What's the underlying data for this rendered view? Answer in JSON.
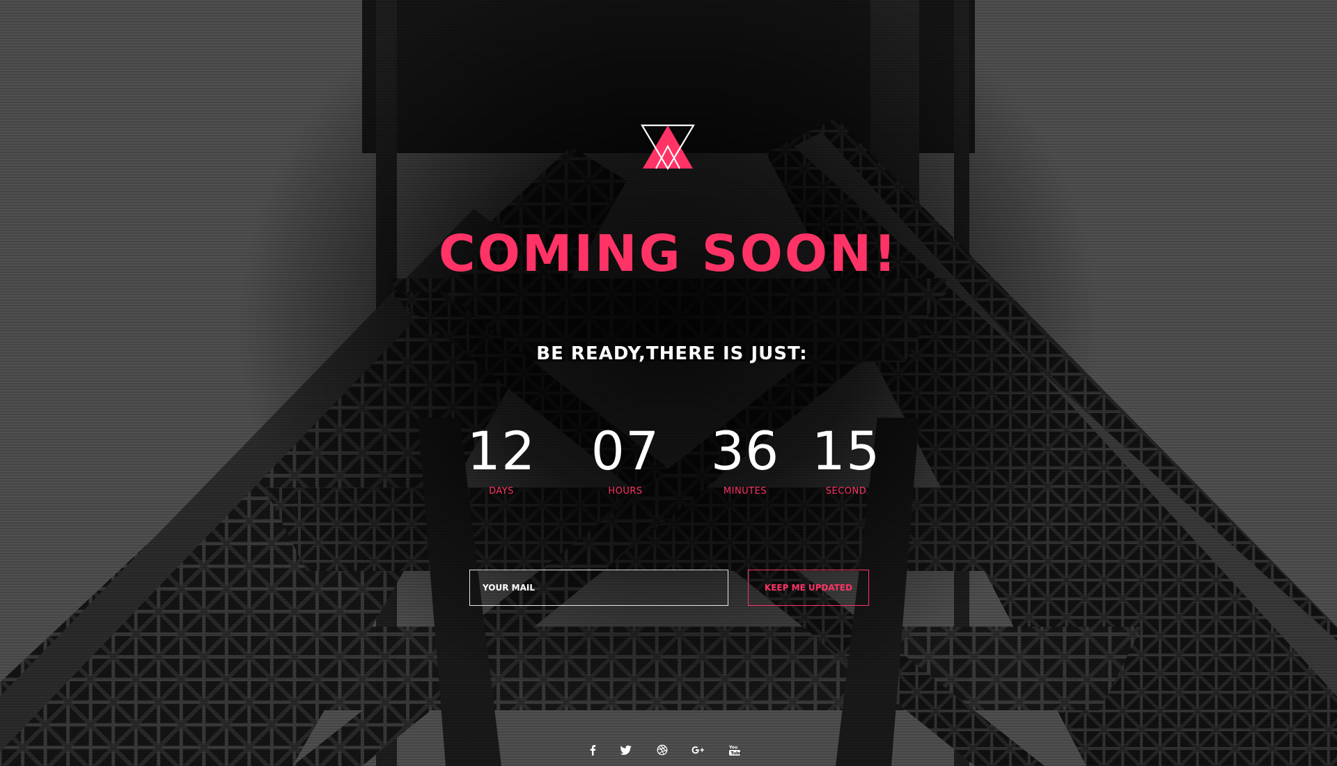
{
  "brand": {
    "accent_color": "#ff3366",
    "logo_icon": "triangle-logo-icon"
  },
  "hero": {
    "title": "COMING SOON!",
    "subtitle": "BE READY,THERE IS JUST:"
  },
  "countdown": [
    {
      "value": "12",
      "label": "DAYS"
    },
    {
      "value": "07",
      "label": "HOURS"
    },
    {
      "value": "36",
      "label": "MINUTES"
    },
    {
      "value": "15",
      "label": "SECOND"
    }
  ],
  "subscribe": {
    "email_placeholder": "YOUR MAIL",
    "email_value": "",
    "button_label": "KEEP ME UPDATED"
  },
  "social": [
    {
      "icon": "facebook-icon",
      "glyph": "f"
    },
    {
      "icon": "twitter-icon",
      "glyph": "t"
    },
    {
      "icon": "dribbble-icon",
      "glyph": "d"
    },
    {
      "icon": "google-plus-icon",
      "glyph": "g+"
    },
    {
      "icon": "youtube-icon",
      "glyph": "yt"
    }
  ]
}
